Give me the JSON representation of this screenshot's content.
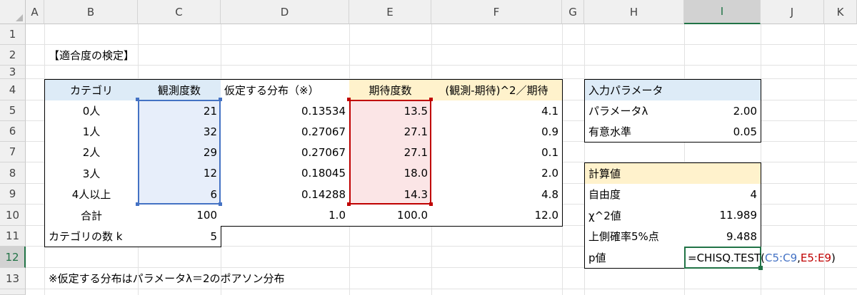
{
  "columns": [
    "A",
    "B",
    "C",
    "D",
    "E",
    "F",
    "G",
    "H",
    "I",
    "J",
    "K"
  ],
  "rows": [
    "1",
    "2",
    "3",
    "4",
    "5",
    "6",
    "7",
    "8",
    "9",
    "10",
    "11",
    "12",
    "13"
  ],
  "selected_column": "I",
  "selected_row": "12",
  "title": "【適合度の検定】",
  "note": "※仮定する分布はパラメータλ＝2のポアソン分布",
  "table": {
    "headers": [
      "カテゴリ",
      "観測度数",
      "仮定する分布（※）",
      "期待度数",
      "(観測-期待)^2／期待"
    ],
    "rows": [
      [
        "0人",
        "21",
        "0.13534",
        "13.5",
        "4.1"
      ],
      [
        "1人",
        "32",
        "0.27067",
        "27.1",
        "0.9"
      ],
      [
        "2人",
        "29",
        "0.27067",
        "27.1",
        "0.1"
      ],
      [
        "3人",
        "12",
        "0.18045",
        "18.0",
        "2.0"
      ],
      [
        "4人以上",
        "6",
        "0.14288",
        "14.3",
        "4.8"
      ]
    ],
    "total": [
      "合計",
      "100",
      "1.0",
      "100.0",
      "12.0"
    ],
    "k_label": "カテゴリの数 k",
    "k_value": "5"
  },
  "params": {
    "header": "入力パラメータ",
    "rows": [
      [
        "パラメータλ",
        "2.00"
      ],
      [
        "有意水準",
        "0.05"
      ]
    ]
  },
  "calc": {
    "header": "計算値",
    "rows": [
      [
        "自由度",
        "4"
      ],
      [
        "χ^2値",
        "11.989"
      ],
      [
        "上側確率5%点",
        "9.488"
      ]
    ],
    "p_label": "p値",
    "formula_prefix": "=CHISQ.TEST(",
    "formula_ref1": "C5:C9",
    "formula_sep": ",",
    "formula_ref2": "E5:E9",
    "formula_suffix": ")"
  },
  "colors": {
    "header_blue": "#ddebf7",
    "header_yellow": "#fff2cc",
    "range_blue": "#4472c4",
    "range_red": "#c00000",
    "excel_green": "#217346"
  }
}
